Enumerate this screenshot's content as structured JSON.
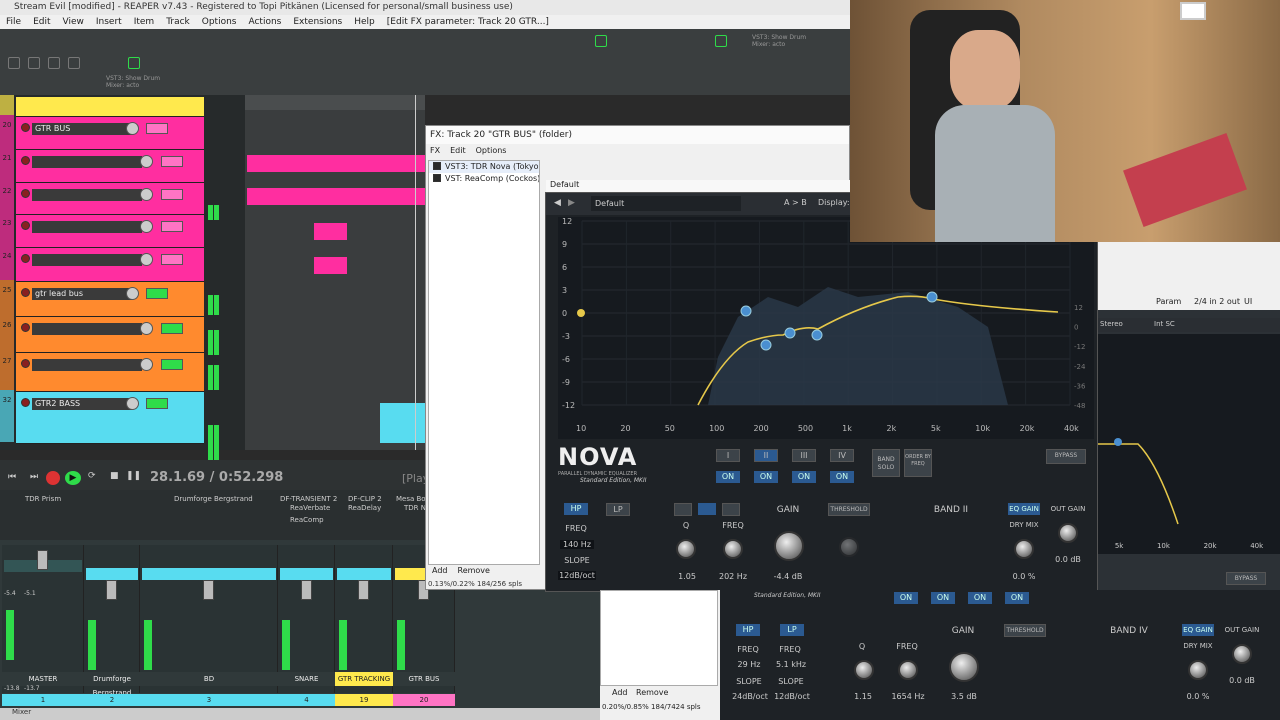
{
  "window": {
    "title": "Stream Evil [modified] - REAPER v7.43 - Registered to Topi Pitkänen (Licensed for personal/small business use)"
  },
  "menu": [
    "File",
    "Edit",
    "View",
    "Insert",
    "Item",
    "Track",
    "Options",
    "Actions",
    "Extensions",
    "Help",
    "[Edit FX parameter: Track 20 GTR...]"
  ],
  "toolbar": {
    "vst_label": "VST3: Show Drum Mixer: acto",
    "vst_label2": "VST3: Show Drum Mixer: acto"
  },
  "tracks": [
    {
      "num": "",
      "name": "",
      "color": "#ffe94d"
    },
    {
      "num": "20",
      "name": "GTR BUS",
      "color": "#ff2ea0"
    },
    {
      "num": "21",
      "name": "",
      "color": "#ff2ea0"
    },
    {
      "num": "22",
      "name": "",
      "color": "#ff2ea0"
    },
    {
      "num": "23",
      "name": "",
      "color": "#ff2ea0"
    },
    {
      "num": "24",
      "name": "",
      "color": "#ff2ea0"
    },
    {
      "num": "25",
      "name": "gtr lead bus",
      "color": "#ff8a2e"
    },
    {
      "num": "26",
      "name": "",
      "color": "#ff8a2e"
    },
    {
      "num": "27",
      "name": "",
      "color": "#ff8a2e"
    },
    {
      "num": "32",
      "name": "GTR2 BASS",
      "color": "#58dcf0"
    }
  ],
  "transport": {
    "position": "28.1.69 / 0:52.298",
    "play_label": "[Play"
  },
  "mixer": {
    "plugins": [
      "TDR Prism",
      "Drumforge Bergstrand",
      "DF-TRANSIENT 2",
      "DF-CLIP 2",
      "Mesa Bo",
      "ReaVerbate",
      "ReaDelay",
      "TDR N",
      "ReaComp"
    ],
    "strips": [
      "MASTER",
      "Drumforge Bergstrand",
      "BD",
      "SNARE",
      "GTR TRACKING",
      "GTR BUS"
    ],
    "strip_nums": [
      "1",
      "2",
      "3",
      "4",
      "19",
      "20"
    ],
    "master_db": [
      "-13.8",
      "-13.7"
    ],
    "meter_db": [
      "-5.4",
      "-5.1"
    ],
    "label": "Mixer"
  },
  "fx_window": {
    "title": "FX: Track 20 \"GTR BUS\" (folder)",
    "menu": [
      "FX",
      "Edit",
      "Options"
    ],
    "plugins": [
      "VST3: TDR Nova (Tokyo D...",
      "VST: ReaComp (Cockos)"
    ],
    "preset_bar": "Default",
    "preset": "Default",
    "ab": "A > B",
    "display": "Display: O",
    "add": "Add",
    "remove": "Remove",
    "cpu": "0.13%/0.22% 184/256 spls"
  },
  "nova": {
    "logo": "NOVA",
    "subtitle": "PARALLEL DYNAMIC EQUALIZER",
    "edition": "Standard Edition, MKII",
    "db_left": [
      "12",
      "9",
      "6",
      "3",
      "0",
      "-3",
      "-6",
      "-9",
      "-12"
    ],
    "db_right": [
      "12",
      "0",
      "-12",
      "-24",
      "-36",
      "-48"
    ],
    "freq": [
      "10",
      "20",
      "50",
      "100",
      "200",
      "500",
      "1k",
      "2k",
      "5k",
      "10k",
      "20k",
      "40k"
    ],
    "bands": [
      "I",
      "II",
      "III",
      "IV"
    ],
    "on": "ON",
    "band_solo": "BAND SOLO",
    "order": "ORDER BY FREQ",
    "bypass": "BYPASS",
    "hp": "HP",
    "lp": "LP",
    "freq_lbl": "FREQ",
    "slope_lbl": "SLOPE",
    "hp_freq": "140 Hz",
    "hp_slope": "12dB/oct",
    "q_lbl": "Q",
    "q_val": "1.05",
    "band_freq_lbl": "FREQ",
    "band_freq_val": "202 Hz",
    "gain_lbl": "GAIN",
    "gain_val": "-4.4 dB",
    "threshold": "THRESHOLD",
    "band_title": "BAND II",
    "eq_gain": "EQ GAIN",
    "dry_mix": "DRY MIX",
    "dry_val": "0.0 %",
    "out_gain": "OUT GAIN",
    "out_val": "0.0 dB"
  },
  "second": {
    "param": "Param",
    "io": "2/4 in 2 out",
    "ui": "UI",
    "stereo": "Stereo",
    "sc": "Int SC",
    "on": [
      "ON",
      "ON",
      "ON",
      "ON"
    ],
    "hp": "HP",
    "lp": "LP",
    "freq": "FREQ",
    "slope": "SLOPE",
    "hp_freq": "29 Hz",
    "lp_freq": "5.1 kHz",
    "hp_slope": "24dB/oct",
    "lp_slope": "12dB/oct",
    "q": "Q",
    "q_val": "1.15",
    "f2": "FREQ",
    "f2_val": "1654 Hz",
    "gain": "GAIN",
    "gain_val": "3.5 dB",
    "threshold": "THRESHOLD",
    "band": "BAND IV",
    "eq_gain": "EQ GAIN",
    "dry_mix": "DRY MIX",
    "dry_val": "0.0 %",
    "out_gain": "OUT GAIN",
    "out_val": "0.0 dB",
    "add": "Add",
    "remove": "Remove",
    "cpu": "0.20%/0.85% 184/7424 spls",
    "freqs": [
      "5k",
      "10k",
      "20k",
      "40k"
    ],
    "edition": "Standard Edition, MKII",
    "bypass": "BYPASS"
  }
}
